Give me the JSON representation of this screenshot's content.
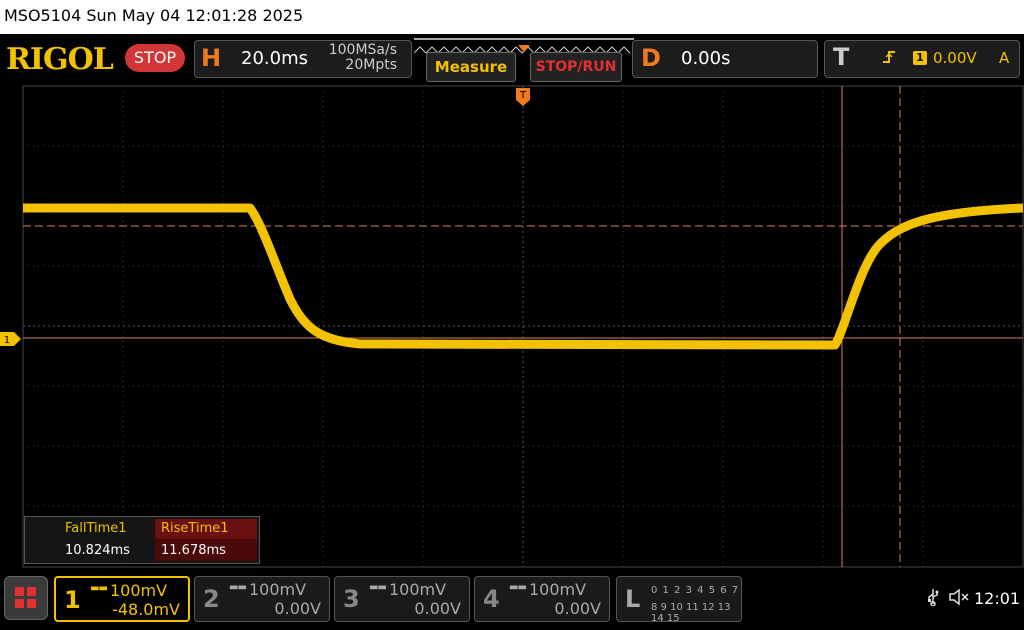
{
  "header": {
    "title_text": "MSO5104  Sun May 04 12:01:28 2025",
    "brand": "RIGOL",
    "run_state": "STOP"
  },
  "horizontal": {
    "letter": "H",
    "timebase": "20.0ms",
    "sample_rate": "100MSa/s",
    "memory_depth": "20Mpts"
  },
  "buttons": {
    "measure": "Measure",
    "stop_run": "STOP/RUN"
  },
  "delay": {
    "letter": "D",
    "value": "0.00s"
  },
  "trigger": {
    "letter": "T",
    "edge_icon": "rising-edge-icon",
    "source": "1",
    "level": "0.00V",
    "mode": "A"
  },
  "waveform": {
    "color": "#f2c200",
    "marker_label": "1"
  },
  "measurements": {
    "fall_label": "FallTime1",
    "fall_value": "10.824ms",
    "rise_label": "RiseTime1",
    "rise_value": "11.678ms"
  },
  "channels": [
    {
      "num": "1",
      "scale": "100mV",
      "offset": "-48.0mV",
      "active": true
    },
    {
      "num": "2",
      "scale": "100mV",
      "offset": "0.00V",
      "active": false
    },
    {
      "num": "3",
      "scale": "100mV",
      "offset": "0.00V",
      "active": false
    },
    {
      "num": "4",
      "scale": "100mV",
      "offset": "0.00V",
      "active": false
    }
  ],
  "logic": {
    "letter": "L",
    "row1": "0 1 2 3   4 5 6 7",
    "row2": "8 9 10 11 12 13 14 15"
  },
  "status": {
    "usb_icon": "usb-icon",
    "sound_icon": "speaker-muted-icon",
    "time": "12:01"
  },
  "colors": {
    "accent_orange": "#f07a1a",
    "channel1_yellow": "#f2c200",
    "stop_red": "#d23535"
  }
}
